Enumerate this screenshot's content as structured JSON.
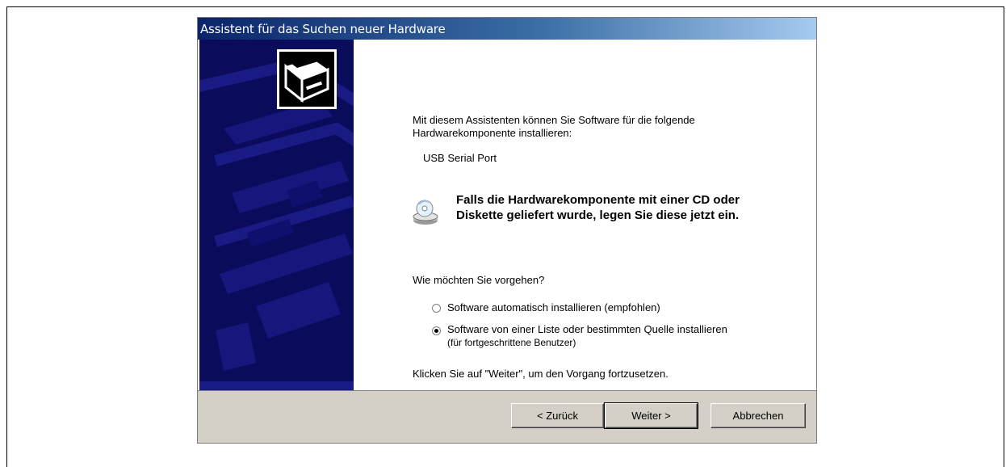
{
  "window": {
    "title": "Assistent für das Suchen neuer Hardware"
  },
  "content": {
    "intro_line1": "Mit diesem Assistenten können Sie Software für die folgende",
    "intro_line2": "Hardwarekomponente installieren:",
    "device_name": "USB Serial Port",
    "cd_note_line1": "Falls die Hardwarekomponente mit einer CD oder",
    "cd_note_line2": "Diskette geliefert wurde, legen Sie diese jetzt ein.",
    "question": "Wie möchten Sie vorgehen?",
    "options": [
      {
        "label": "Software automatisch installieren (empfohlen)",
        "sublabel": "",
        "selected": false
      },
      {
        "label": "Software von einer Liste oder bestimmten Quelle installieren",
        "sublabel": "(für fortgeschrittene Benutzer)",
        "selected": true
      }
    ],
    "continue_hint": "Klicken Sie auf \"Weiter\", um den Vorgang fortzusetzen."
  },
  "buttons": {
    "back": "< Zurück",
    "next": "Weiter >",
    "cancel": "Abbrechen"
  },
  "icons": {
    "wizard_banner": "hardware-wizard-icon",
    "cd": "cd-drive-icon"
  },
  "colors": {
    "titlebar_start": "#0a246a",
    "titlebar_end": "#a6caf0",
    "sidebar": "#0b0b5c",
    "footer": "#d4d0c8"
  }
}
